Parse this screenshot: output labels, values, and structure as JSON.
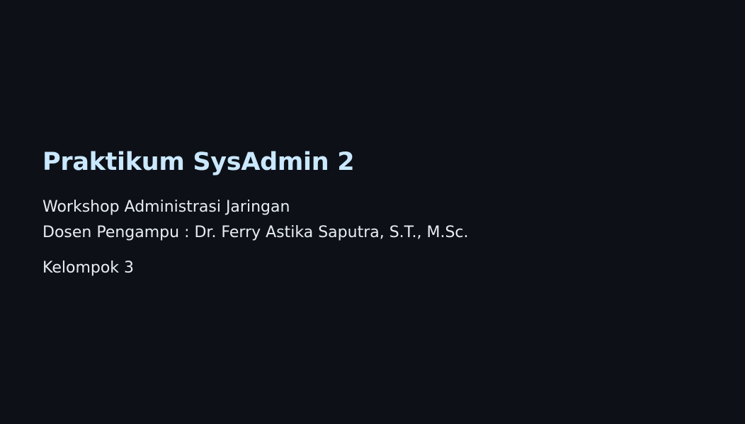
{
  "slide": {
    "title": "Praktikum SysAdmin 2",
    "subtitle": "Workshop Administrasi Jaringan",
    "lecturer": "Dosen Pengampu : Dr. Ferry Astika Saputra, S.T., M.Sc.",
    "group": "Kelompok 3"
  },
  "colors": {
    "background": "#0d1117",
    "title": "#cae8ff",
    "text": "#e6edf3"
  }
}
